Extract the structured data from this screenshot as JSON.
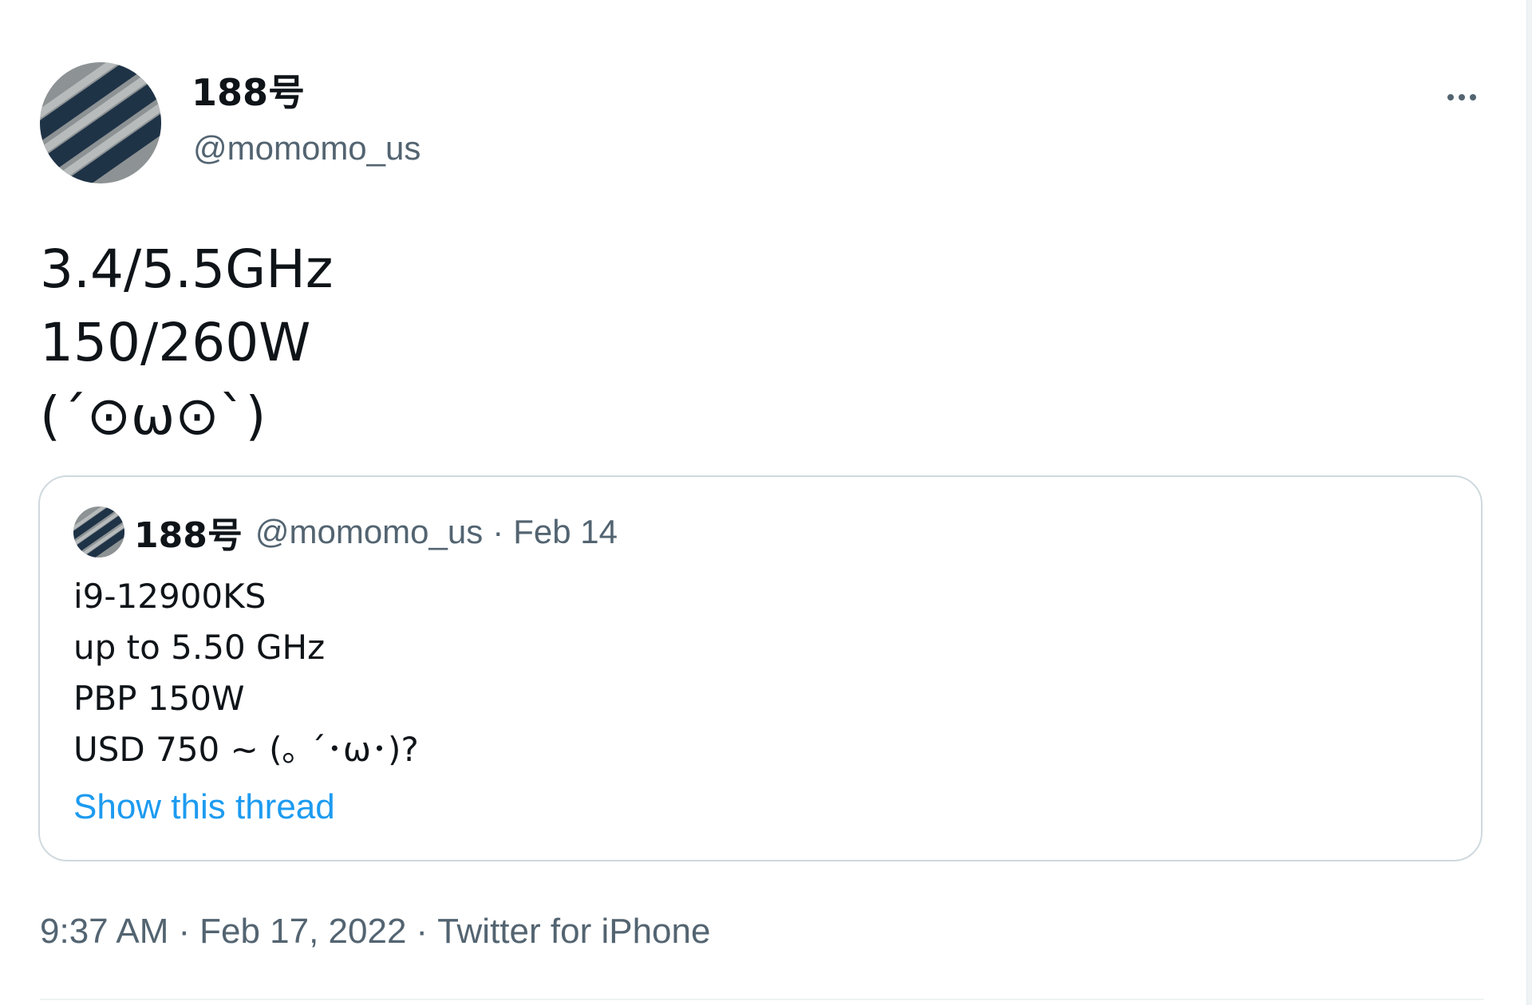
{
  "author": {
    "display_name": "188号",
    "handle": "@momomo_us",
    "avatar_icon": "striped-avatar-icon"
  },
  "menu": {
    "more_icon": "more-horizontal-icon"
  },
  "tweet": {
    "lines": [
      "3.4/5.5GHz",
      "150/260W",
      "(´⊙ω⊙`)"
    ]
  },
  "quote": {
    "display_name": "188号",
    "handle": "@momomo_us",
    "separator": "·",
    "date": "Feb 14",
    "lines": [
      "i9-12900KS",
      "up to 5.50 GHz",
      "PBP 150W",
      "USD 750 ~ (｡ ´･ω･)?"
    ],
    "show_thread_label": "Show this thread"
  },
  "meta": {
    "time": "9:37 AM",
    "separator": "·",
    "date": "Feb 17, 2022",
    "source": "Twitter for iPhone"
  },
  "colors": {
    "text_primary": "#0f1419",
    "text_secondary": "#536471",
    "link": "#1d9bf0",
    "border": "#cfd9de"
  }
}
